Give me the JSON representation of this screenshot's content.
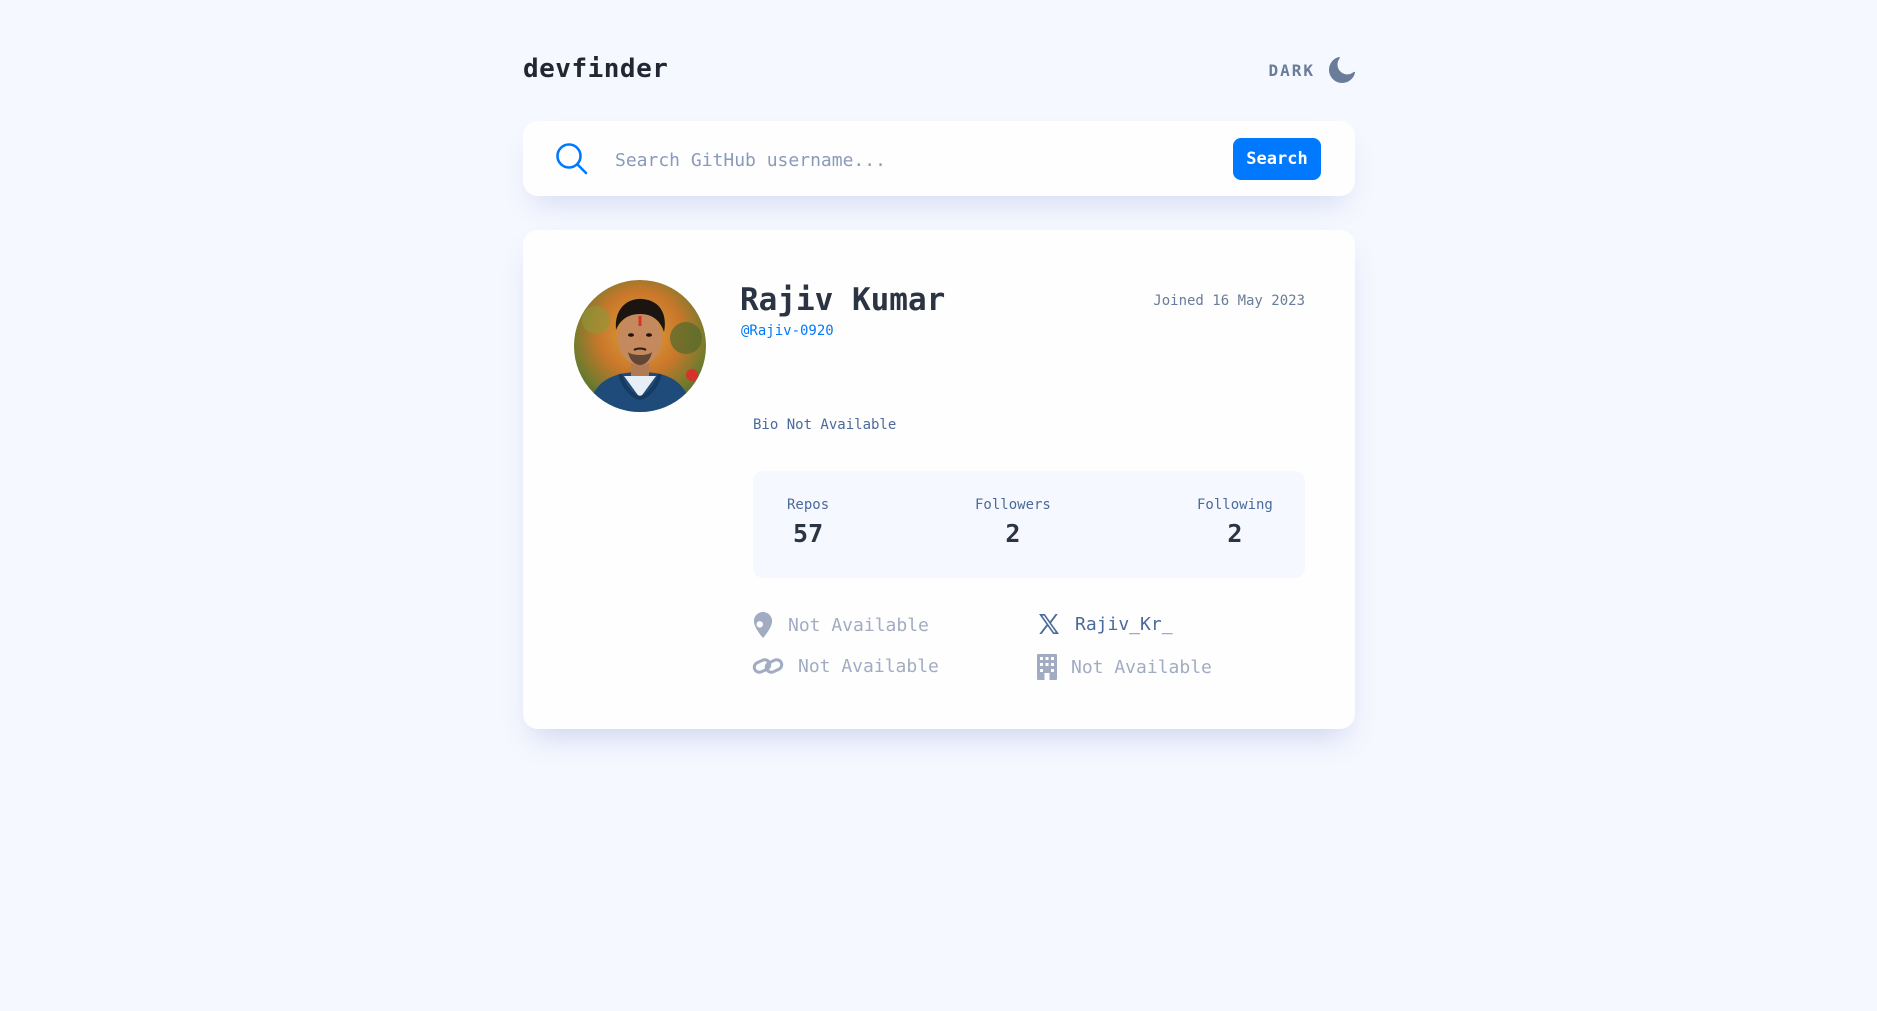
{
  "header": {
    "logo": "devfinder",
    "theme_label": "DARK",
    "theme_icon": "moon-icon"
  },
  "search": {
    "placeholder": "Search GitHub username...",
    "value": "",
    "button_label": "Search",
    "icon": "search-icon"
  },
  "profile": {
    "name": "Rajiv Kumar",
    "login": "@Rajiv-0920",
    "joined": "Joined 16 May 2023",
    "bio": "Bio Not Available",
    "stats": [
      {
        "label": "Repos",
        "value": "57"
      },
      {
        "label": "Followers",
        "value": "2"
      },
      {
        "label": "Following",
        "value": "2"
      }
    ],
    "links": {
      "location": {
        "icon": "location-pin-icon",
        "text": "Not Available"
      },
      "twitter": {
        "icon": "x-twitter-icon",
        "text": "Rajiv_Kr_"
      },
      "website": {
        "icon": "link-icon",
        "text": "Not Available"
      },
      "company": {
        "icon": "building-icon",
        "text": "Not Available"
      }
    }
  },
  "colors": {
    "background": "#f6f8ff",
    "card": "#fefefe",
    "accent": "#0079ff",
    "text_primary": "#2b3442",
    "text_secondary": "#4b6a9b",
    "muted": "#a1acc3"
  }
}
